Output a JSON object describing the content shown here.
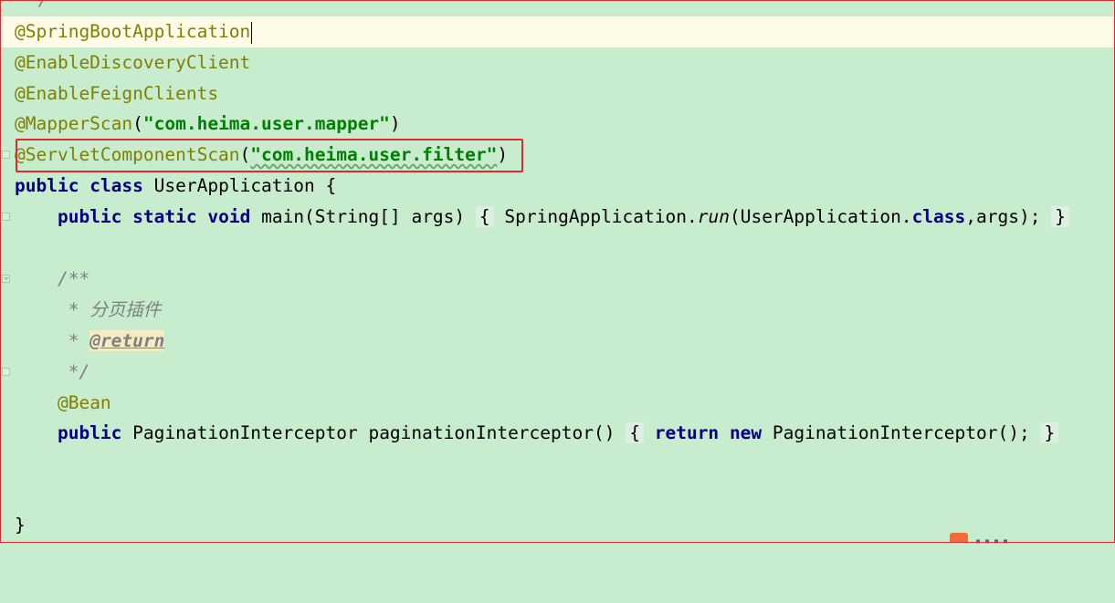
{
  "editor": {
    "top_comment": "*/",
    "lines": {
      "l1_annotation": "@SpringBootApplication",
      "l2_annotation": "@EnableDiscoveryClient",
      "l3_annotation": "@EnableFeignClients",
      "l4_annotation": "@MapperScan",
      "l4_string": "\"com.heima.user.mapper\"",
      "l5_annotation": "@ServletComponentScan",
      "l5_string": "\"com.heima.user.filter\"",
      "l6_kw1": "public",
      "l6_kw2": "class",
      "l6_rest": "UserApplication {",
      "l7_kw1": "public",
      "l7_kw2": "static",
      "l7_kw3": "void",
      "l7_sig": "main(String[] args)",
      "l7_open": "{",
      "l7_call1": "SpringApplication.",
      "l7_run": "run",
      "l7_call2": "(UserApplication.",
      "l7_class": "class",
      "l7_call3": ",args);",
      "l7_close": "}",
      "l9_comment": "/**",
      "l10_comment": " * 分页插件",
      "l11_star": " * ",
      "l11_tag": "@return",
      "l12_comment": " */",
      "l13_annotation": "@Bean",
      "l14_kw1": "public",
      "l14_sig": "PaginationInterceptor paginationInterceptor()",
      "l14_open": "{",
      "l14_kw2": "return",
      "l14_kw3": "new",
      "l14_call": "PaginationInterceptor();",
      "l14_close": "}",
      "l17_close": "}"
    }
  },
  "colors": {
    "background": "#c7ecce",
    "current_line": "#fefbe8",
    "annotation": "#808000",
    "keyword": "#000080",
    "string": "#008000",
    "comment": "#808080",
    "highlight_box": "#e0282e"
  }
}
